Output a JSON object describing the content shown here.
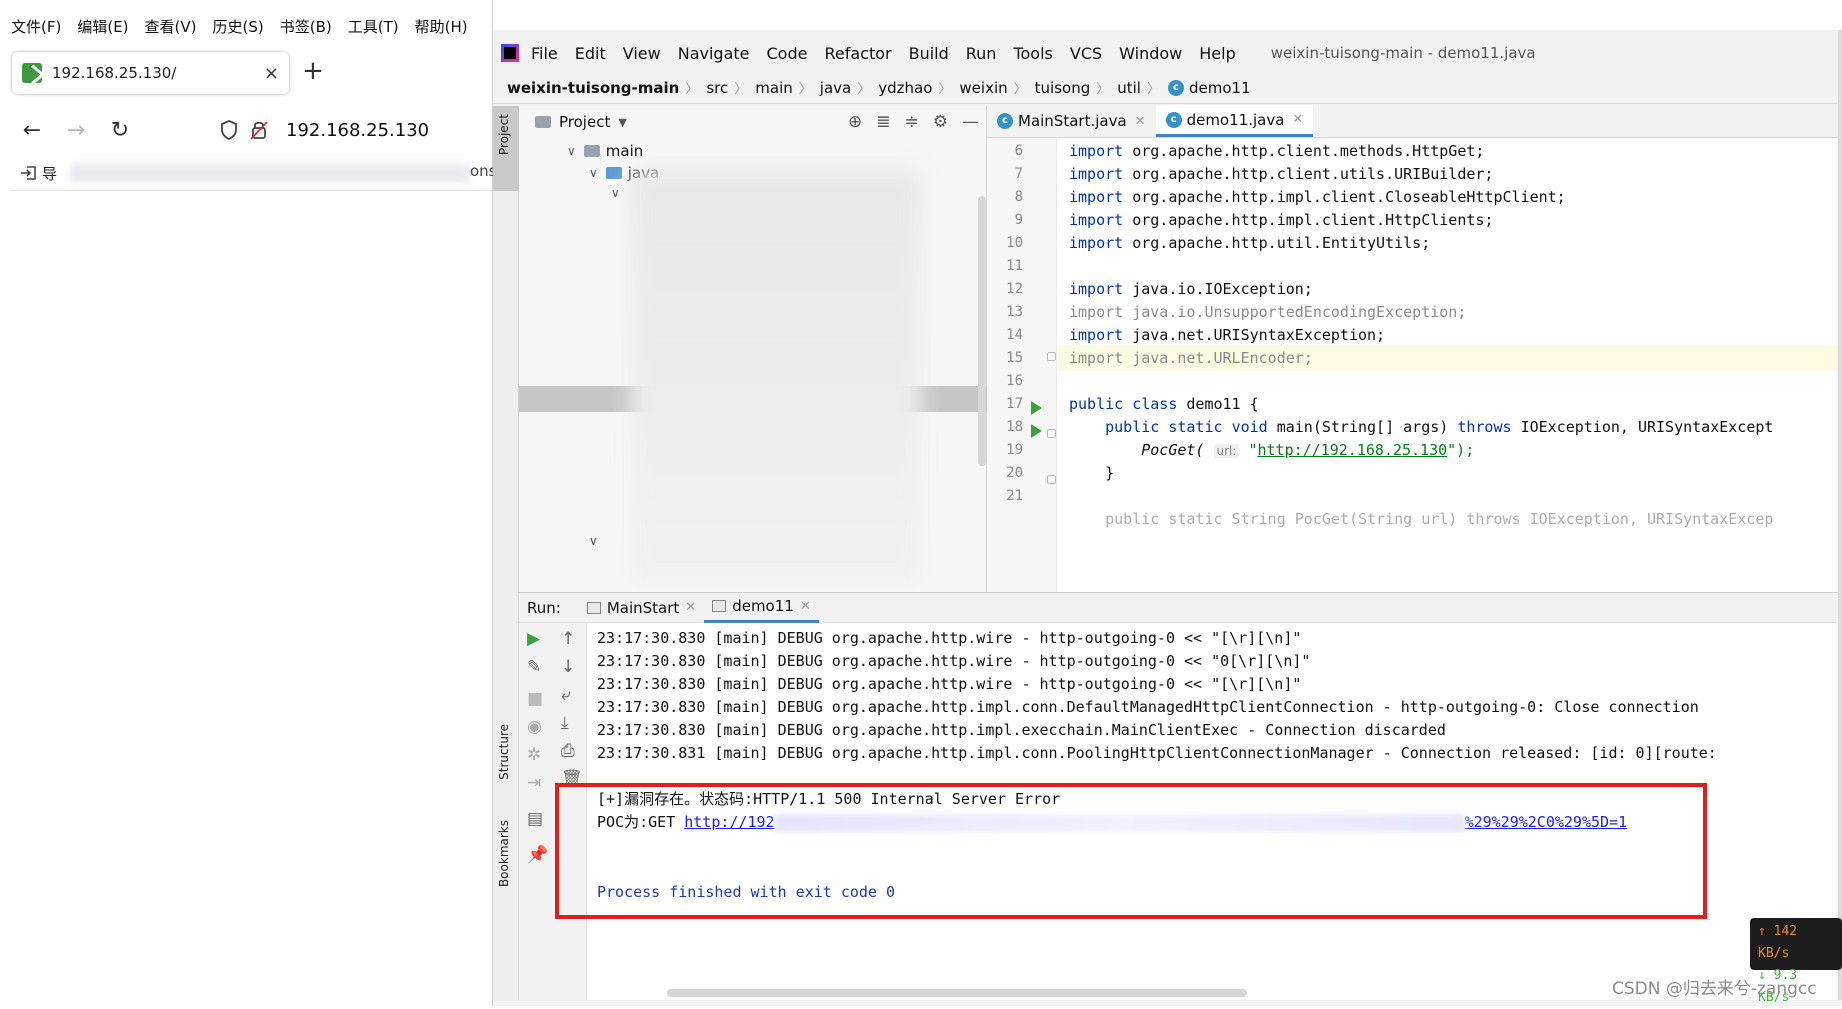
{
  "browser": {
    "menu": [
      "文件(F)",
      "编辑(E)",
      "查看(V)",
      "历史(S)",
      "书签(B)",
      "工具(T)",
      "帮助(H)"
    ],
    "tab_title": "192.168.25.130/",
    "tab_close": "×",
    "new_tab": "+",
    "back": "←",
    "forward": "→",
    "reload": "↻",
    "url": "192.168.25.130",
    "bookmark_item": "导",
    "bookmark_tail": "ons"
  },
  "ide": {
    "menu": [
      "File",
      "Edit",
      "View",
      "Navigate",
      "Code",
      "Refactor",
      "Build",
      "Run",
      "Tools",
      "VCS",
      "Window",
      "Help"
    ],
    "window_title": "weixin-tuisong-main - demo11.java",
    "breadcrumb": [
      "weixin-tuisong-main",
      "src",
      "main",
      "java",
      "ydzhao",
      "weixin",
      "tuisong",
      "util",
      "demo11"
    ],
    "side_labels": {
      "project": "Project",
      "structure": "Structure",
      "bookmarks": "Bookmarks"
    },
    "project_panel": {
      "title": "Project",
      "tree": [
        {
          "label": "main",
          "indent": 1
        },
        {
          "label": "java",
          "indent": 2
        }
      ]
    },
    "editor_tabs": [
      {
        "label": "MainStart.java",
        "active": false
      },
      {
        "label": "demo11.java",
        "active": true
      }
    ],
    "code": {
      "line_numbers": [
        "6",
        "7",
        "8",
        "9",
        "10",
        "11",
        "12",
        "13",
        "14",
        "15",
        "16",
        "17",
        "18",
        "19",
        "20",
        "21"
      ],
      "lines": {
        "l6": "org.apache.http.client.methods.HttpGet;",
        "l7": "org.apache.http.client.utils.URIBuilder;",
        "l8": "org.apache.http.impl.client.CloseableHttpClient;",
        "l9": "org.apache.http.impl.client.HttpClients;",
        "l10": "org.apache.http.util.EntityUtils;",
        "l12": "java.io.IOException;",
        "l13": "java.io.UnsupportedEncodingException;",
        "l14": "java.net.URISyntaxException;",
        "l15": "java.net.URLEncoder;",
        "l17_class": "demo11 {",
        "l18_sig": "main(String[] args)",
        "l18_throws": "IOException, URISyntaxExcept",
        "l19_call": "PocGet(",
        "l19_hint": "url:",
        "l19_url": "http://192.168.25.130",
        "l19_end": "\");",
        "l20": "}",
        "l22_partial": "public static String PocGet(String url) throws IOException, URISyntaxExcep"
      },
      "keywords": {
        "import": "import",
        "public": "public",
        "static": "static",
        "void": "void",
        "class": "class",
        "throws": "throws"
      }
    },
    "run": {
      "label": "Run:",
      "tabs": [
        {
          "label": "MainStart",
          "active": false
        },
        {
          "label": "demo11",
          "active": true
        }
      ],
      "console": [
        "23:17:30.830 [main] DEBUG org.apache.http.wire - http-outgoing-0 << \"[\\r][\\n]\"",
        "23:17:30.830 [main] DEBUG org.apache.http.wire - http-outgoing-0 << \"0[\\r][\\n]\"",
        "23:17:30.830 [main] DEBUG org.apache.http.wire - http-outgoing-0 << \"[\\r][\\n]\"",
        "23:17:30.830 [main] DEBUG org.apache.http.impl.conn.DefaultManagedHttpClientConnection - http-outgoing-0: Close connection",
        "23:17:30.830 [main] DEBUG org.apache.http.impl.execchain.MainClientExec - Connection discarded",
        "23:17:30.831 [main] DEBUG org.apache.http.impl.conn.PoolingHttpClientConnectionManager - Connection released: [id: 0][route:"
      ],
      "vuln_line": "[+]漏洞存在。状态码:HTTP/1.1 500 Internal Server Error",
      "poc_prefix": "POC为:GET ",
      "poc_link_start": "http://192",
      "poc_link_end": "%29%29%2C0%29%5D=1",
      "exit_line": "Process finished with exit code 0"
    }
  },
  "overlay": {
    "speed_up": "↑ 142 KB/s",
    "speed_down": "↓ 9.3 KB/s",
    "watermark": "CSDN @归去来兮-zangcc"
  },
  "colors": {
    "keyword": "#0033b3",
    "string": "#067d17",
    "highlight_box": "#e11e1e",
    "active_tab": "#4083c9"
  }
}
